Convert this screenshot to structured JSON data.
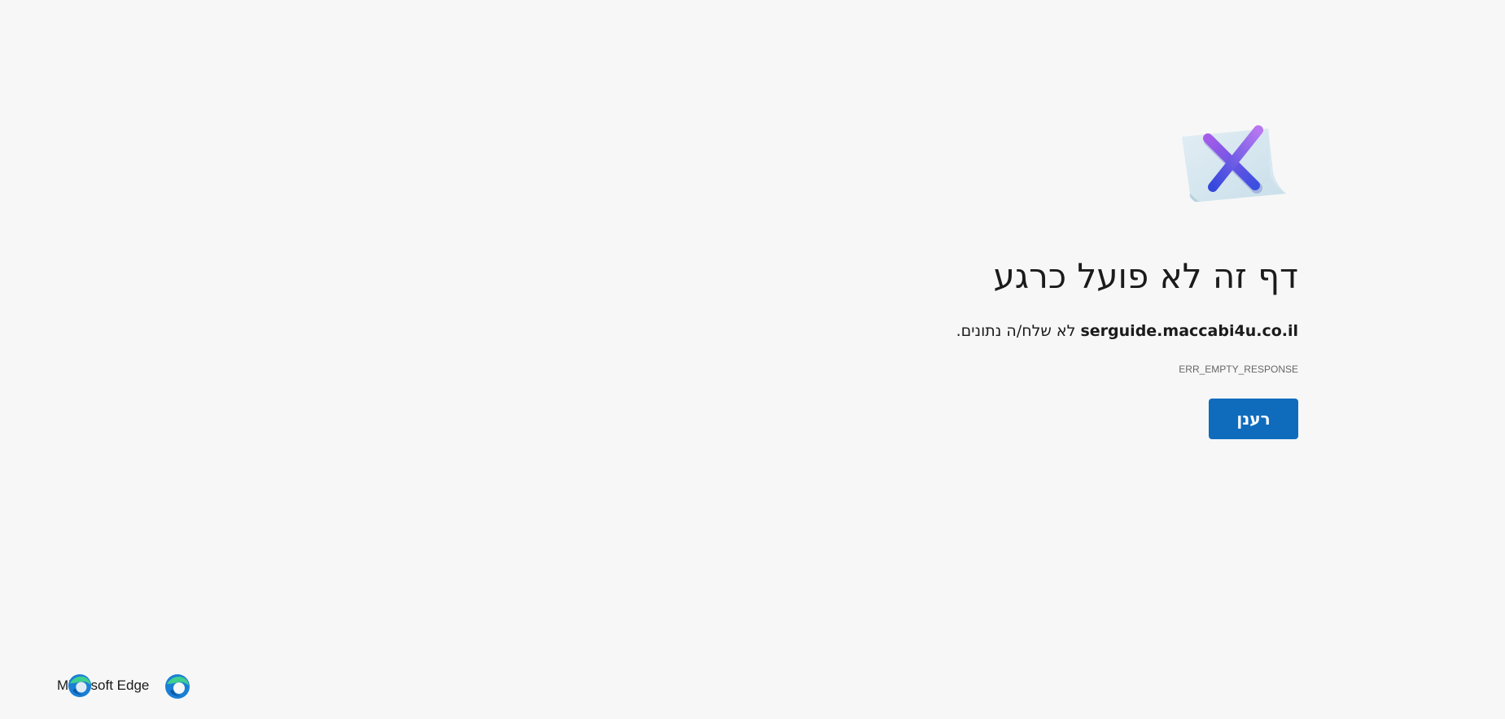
{
  "error": {
    "title": "דף זה לא פועל כרגע",
    "host": "serguide.maccabi4u.co.il",
    "message_suffix": " לא שלח/ה נתונים.",
    "code": "ERR_EMPTY_RESPONSE",
    "refresh_label": "רענן",
    "illustration_icon": "error-x-paper-icon"
  },
  "footer": {
    "brand_text": "Microsoft Edge",
    "logo_icon": "edge-logo-icon"
  },
  "colors": {
    "background": "#f7f7f7",
    "accent": "#0f6cbd",
    "text": "#1b1b1b",
    "muted_text": "#666666"
  }
}
